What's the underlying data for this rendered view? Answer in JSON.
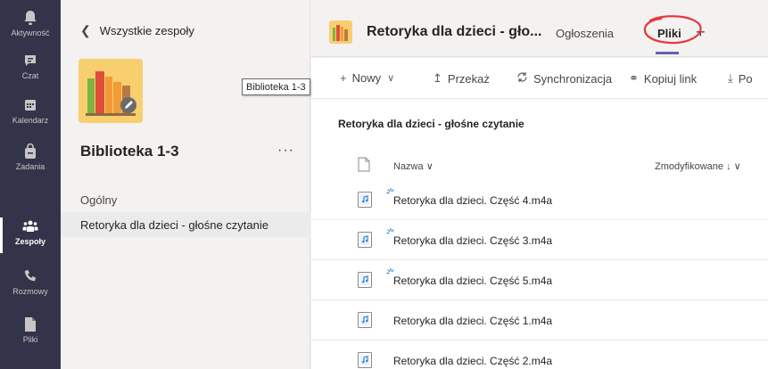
{
  "rail": {
    "items": [
      {
        "label": "Aktywność",
        "icon": "bell-icon"
      },
      {
        "label": "Czat",
        "icon": "chat-icon"
      },
      {
        "label": "Kalendarz",
        "icon": "calendar-icon"
      },
      {
        "label": "Zadania",
        "icon": "bag-icon"
      },
      {
        "label": "Zespoły",
        "icon": "teams-icon"
      },
      {
        "label": "Rozmowy",
        "icon": "phone-icon"
      },
      {
        "label": "Pliki",
        "icon": "file-icon"
      }
    ],
    "active": "Zespoły"
  },
  "team_panel": {
    "back_label": "Wszystkie zespoły",
    "team_name": "Biblioteka 1-3",
    "more_label": "···",
    "channels": [
      "Ogólny",
      "Retoryka dla dzieci - głośne czytanie"
    ],
    "selected_channel": "Retoryka dla dzieci - głośne czytanie"
  },
  "tooltip": "Biblioteka 1-3",
  "header": {
    "title": "Retoryka dla dzieci - gło...",
    "tabs": [
      "Ogłoszenia",
      "Pliki"
    ],
    "active_tab": "Pliki",
    "add_tab": "+"
  },
  "toolbar": {
    "new_label": "Nowy",
    "transfer_label": "Przekaż",
    "sync_label": "Synchronizacja",
    "copy_link_label": "Kopiuj link",
    "download_label": "Po"
  },
  "files": {
    "folder_title": "Retoryka dla dzieci - głośne czytanie",
    "columns": {
      "name": "Nazwa",
      "modified": "Zmodyfikowane ↓"
    },
    "rows": [
      {
        "name": "Retoryka dla dzieci. Część 4.m4a",
        "syncing": true
      },
      {
        "name": "Retoryka dla dzieci. Część 3.m4a",
        "syncing": true
      },
      {
        "name": "Retoryka dla dzieci. Część 5.m4a",
        "syncing": true
      },
      {
        "name": "Retoryka dla dzieci. Część 1.m4a",
        "syncing": false
      },
      {
        "name": "Retoryka dla dzieci. Część 2.m4a",
        "syncing": false
      }
    ]
  },
  "colors": {
    "rail_bg": "#33344a",
    "accent": "#6264a7",
    "annotation": "#e8363d",
    "avatar_bg": "#f7cf6e"
  }
}
